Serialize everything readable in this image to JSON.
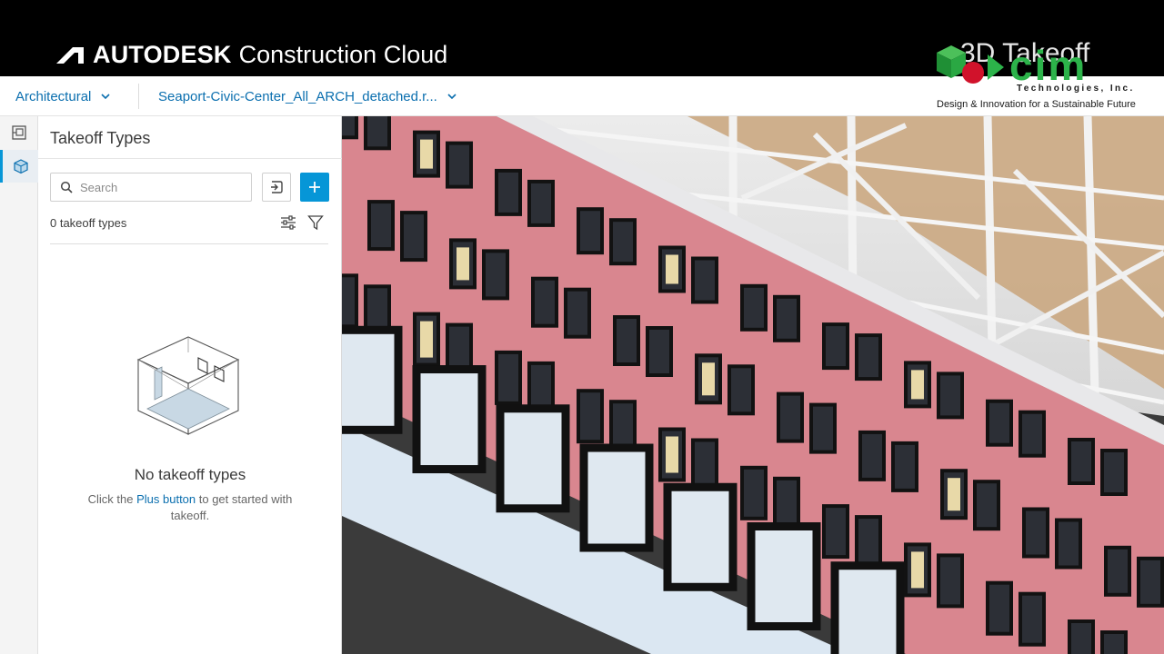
{
  "header": {
    "brand_name": "AUTODESK",
    "brand_product": "Construction Cloud",
    "video_title": "3D Takeoff"
  },
  "watermark": {
    "wordmark": "cim",
    "company": "Technologies, Inc.",
    "tagline": "Design & Innovation for a Sustainable Future"
  },
  "nav": {
    "discipline": "Architectural",
    "model": "Seaport-Civic-Center_All_ARCH_detached.r..."
  },
  "panel": {
    "title": "Takeoff Types",
    "search_placeholder": "Search",
    "count_label": "0 takeoff types",
    "empty_title": "No takeoff types",
    "empty_text_before": "Click the ",
    "empty_link": "Plus button",
    "empty_text_after": " to get started with takeoff."
  },
  "colors": {
    "accent": "#0696d7",
    "link": "#0b6faf",
    "facade": "#d9868f",
    "watermark_green": "#2cb34a"
  },
  "icons": [
    "sheet-icon",
    "model-icon",
    "search-icon",
    "import-icon",
    "plus-icon",
    "settings-sliders-icon",
    "filter-icon",
    "chevron-down-icon"
  ]
}
